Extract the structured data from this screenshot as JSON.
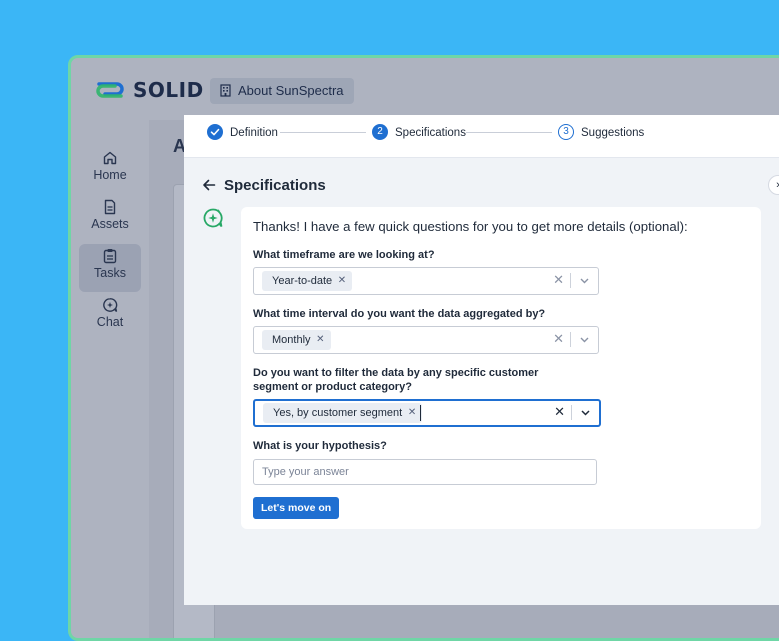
{
  "app": {
    "brand": "SOLID",
    "about_label": "About SunSpectra"
  },
  "sidebar": {
    "items": [
      {
        "label": "Home",
        "icon": "home-icon"
      },
      {
        "label": "Assets",
        "icon": "document-icon"
      },
      {
        "label": "Tasks",
        "icon": "clipboard-icon",
        "active": true
      },
      {
        "label": "Chat",
        "icon": "chat-sparkle-icon"
      }
    ]
  },
  "background": {
    "page_title": "A"
  },
  "stepper": {
    "steps": [
      {
        "number": "",
        "label": "Definition",
        "state": "done"
      },
      {
        "number": "2",
        "label": "Specifications",
        "state": "current"
      },
      {
        "number": "3",
        "label": "Suggestions",
        "state": "todo"
      }
    ]
  },
  "panel": {
    "title": "Specifications",
    "intro": "Thanks! I have a few quick questions for you to get more details (optional):",
    "questions": [
      {
        "label": "What timeframe are we looking at?",
        "selected": "Year-to-date"
      },
      {
        "label": "What time interval do you want the data aggregated by?",
        "selected": "Monthly"
      },
      {
        "label": "Do you want to filter the data by any specific customer segment or product category?",
        "selected": "Yes, by customer segment"
      },
      {
        "label": "What is your hypothesis?",
        "placeholder": "Type your answer"
      }
    ],
    "submit_label": "Let's move on"
  },
  "colors": {
    "accent": "#1f6fd1",
    "outer_background": "#3bb6f6",
    "window_border": "#6fd6a6"
  }
}
